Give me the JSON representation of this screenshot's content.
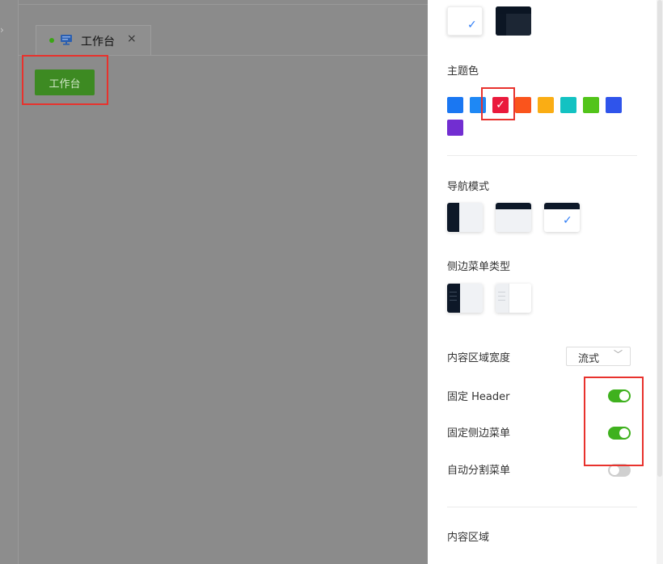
{
  "workspace": {
    "tab": {
      "label": "工作台",
      "close_icon": "×",
      "icon": "monitor-icon",
      "dot_color": "#3aa514"
    },
    "button": {
      "label": "工作台",
      "color": "#3d8a22"
    },
    "collapse_icon": "›"
  },
  "settings": {
    "page_theme": {
      "options": [
        {
          "name": "light",
          "selected": true
        },
        {
          "name": "dark",
          "selected": false
        }
      ],
      "check_glyph": "✓"
    },
    "theme_color": {
      "title": "主题色",
      "swatches": [
        {
          "color": "#1a77f2",
          "selected": false
        },
        {
          "color": "#1e88f5",
          "selected": false
        },
        {
          "color": "#ea1a3c",
          "selected": true
        },
        {
          "color": "#fa541c",
          "selected": false
        },
        {
          "color": "#faad14",
          "selected": false
        },
        {
          "color": "#13c2c2",
          "selected": false
        },
        {
          "color": "#52c41a",
          "selected": false
        },
        {
          "color": "#2f54eb",
          "selected": false
        },
        {
          "color": "#722ed1",
          "selected": false
        }
      ],
      "tick_glyph": "✓"
    },
    "nav_mode": {
      "title": "导航模式",
      "options": [
        {
          "name": "side",
          "selected": false
        },
        {
          "name": "top",
          "selected": false
        },
        {
          "name": "mix",
          "selected": true
        }
      ]
    },
    "side_menu_type": {
      "title": "侧边菜单类型",
      "options": [
        {
          "name": "dark",
          "selected": false
        },
        {
          "name": "light",
          "selected": false
        }
      ]
    },
    "content_width": {
      "label": "内容区域宽度",
      "value": "流式",
      "arrow": "﹀"
    },
    "fixed_header": {
      "label": "固定 Header",
      "on": true
    },
    "fixed_side_menu": {
      "label": "固定侧边菜单",
      "on": true
    },
    "auto_split_menu": {
      "label": "自动分割菜单",
      "on": false
    },
    "content_area": {
      "title": "内容区域"
    }
  },
  "highlight_color": "#e8322d"
}
